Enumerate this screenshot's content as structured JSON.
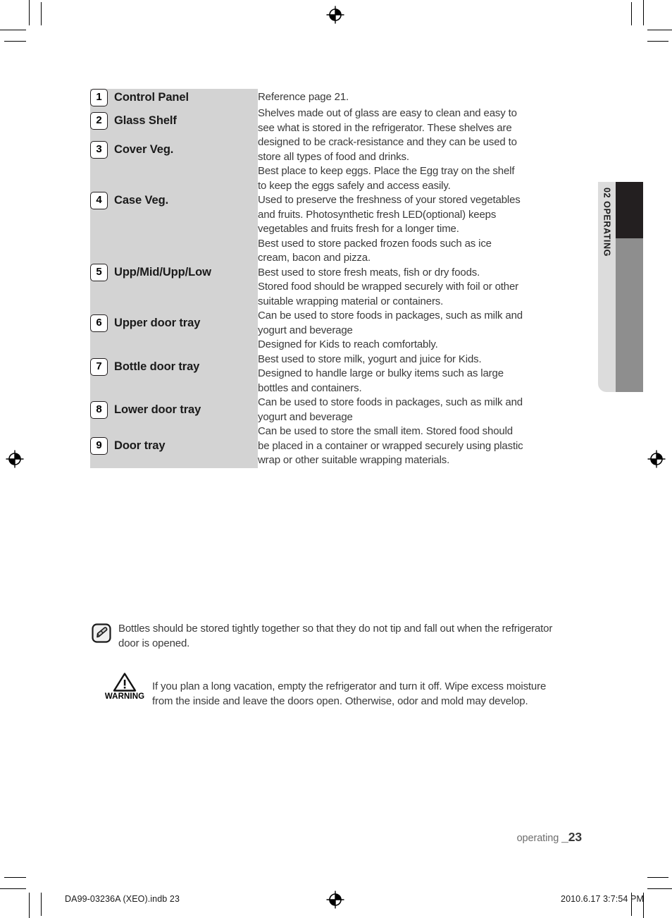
{
  "side_tab": {
    "label": "02 OPERATING",
    "colors": {
      "light": "#dcdcdc",
      "dark": "#231f20",
      "mid": "#8e8e8e"
    }
  },
  "table": {
    "rows": [
      {
        "number": "1",
        "label": "Control Panel",
        "description": [
          "Reference page 21."
        ]
      },
      {
        "number": "2",
        "label": "Glass Shelf",
        "description": [
          "Shelves made out of glass are easy to clean and easy to",
          "see what is stored in the refrigerator. These shelves are",
          "designed to be crack-resistance and they can be used to",
          "store all types of food and drinks."
        ]
      },
      {
        "number": "3",
        "label": "Cover Veg.",
        "description": []
      },
      {
        "number": "4",
        "label": "Case Veg.",
        "description": [
          "Best place to keep eggs. Place the Egg tray on the shelf",
          "to keep the eggs safely and access easily.",
          "Used to preserve the freshness of your stored vegetables",
          "and fruits. Photosynthetic fresh LED(optional) keeps",
          "vegetables and fruits fresh for a longer time."
        ]
      },
      {
        "number": "5",
        "label": "Upp/Mid/Upp/Low",
        "description": [
          "Best used to store packed frozen foods such as ice",
          "cream, bacon and pizza.",
          "Best used to store fresh meats, fish or dry foods.",
          "Stored food should be wrapped securely with foil or other",
          "suitable wrapping material or containers."
        ]
      },
      {
        "number": "6",
        "label": "Upper door tray",
        "description": [
          "Can be used to store foods in packages, such as milk and",
          "yogurt and beverage"
        ]
      },
      {
        "number": "7",
        "label": "Bottle door tray",
        "description": [
          "Designed for Kids to reach comfortably.",
          "Best used to store milk, yogurt and juice for Kids.",
          "Designed to handle large or bulky items such as large",
          "bottles and containers."
        ]
      },
      {
        "number": "8",
        "label": "Lower door tray",
        "description": [
          "Can be used to store foods in packages, such as milk and",
          "yogurt and beverage"
        ]
      },
      {
        "number": "9",
        "label": "Door tray",
        "description": [
          "Can be used to store the small item. Stored food should",
          "be placed in a container or wrapped securely using plastic",
          "wrap or other suitable wrapping materials."
        ]
      }
    ]
  },
  "note": {
    "icon": "note-pen-icon",
    "lines": [
      "Bottles should be stored tightly together so that they do not tip and fall out when the refrigerator",
      "door is opened."
    ]
  },
  "warning": {
    "icon": "warning-triangle-icon",
    "word": "WARNING",
    "lines": [
      "If you plan a long vacation,  empty the refrigerator and turn it off. Wipe excess moisture",
      "from the inside and leave the doors open. Otherwise, odor and mold may develop."
    ]
  },
  "footer": {
    "section_label": "operating ",
    "page_number": "23",
    "print_file": "DA99-03236A (XEO).indb   23",
    "print_date": "2010.6.17   3:7:54 PM"
  }
}
